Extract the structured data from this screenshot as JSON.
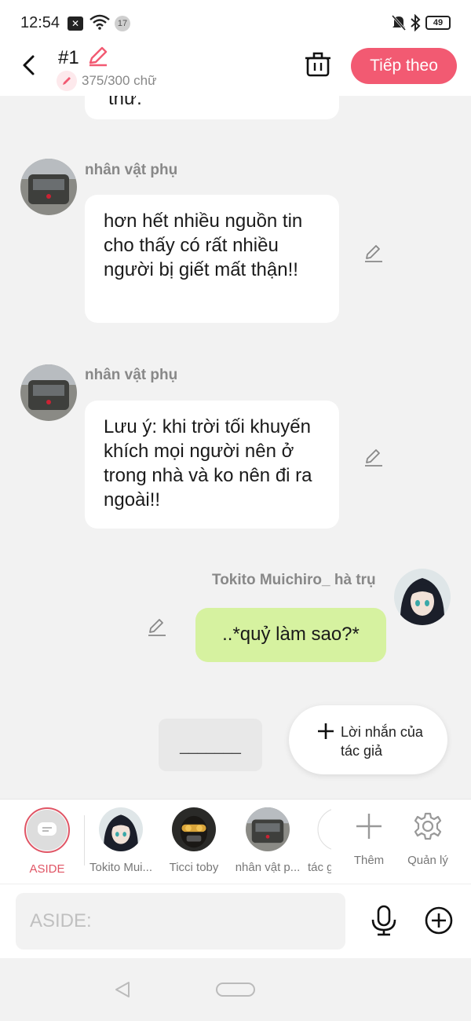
{
  "status_bar": {
    "time": "12:54",
    "notification_count": "17",
    "battery": "49"
  },
  "header": {
    "title": "#1",
    "word_count": "375/300 chữ",
    "next_label": "Tiếp theo"
  },
  "messages": [
    {
      "side": "left",
      "sender": "",
      "text": "thứ."
    },
    {
      "side": "left",
      "sender": "nhân vật phụ",
      "text": "hơn hết nhiều nguồn tin cho thấy có rất nhiều người bị giết mất thận!!"
    },
    {
      "side": "left",
      "sender": "nhân vật phụ",
      "text": "Lưu ý: khi trời tối khuyến khích mọi người nên ở trong nhà và ko nên đi ra ngoài!!"
    },
    {
      "side": "right",
      "sender": "Tokito Muichiro_ hà trụ",
      "text": "..*quỷ làm sao?*"
    }
  ],
  "draft_chip": "_______",
  "author_note_label": "Lời nhắn của tác giả",
  "characters": [
    {
      "label": "ASIDE",
      "active": true
    },
    {
      "label": "Tokito Mui..."
    },
    {
      "label": "Ticci toby"
    },
    {
      "label": "nhân vật p..."
    },
    {
      "label": "tác g"
    }
  ],
  "add_label": "Thêm",
  "manage_label": "Quản lý",
  "input": {
    "placeholder": "ASIDE:"
  },
  "colors": {
    "accent": "#f25a72",
    "own_bubble": "#d6f2a0",
    "background": "#f2f2f2"
  }
}
